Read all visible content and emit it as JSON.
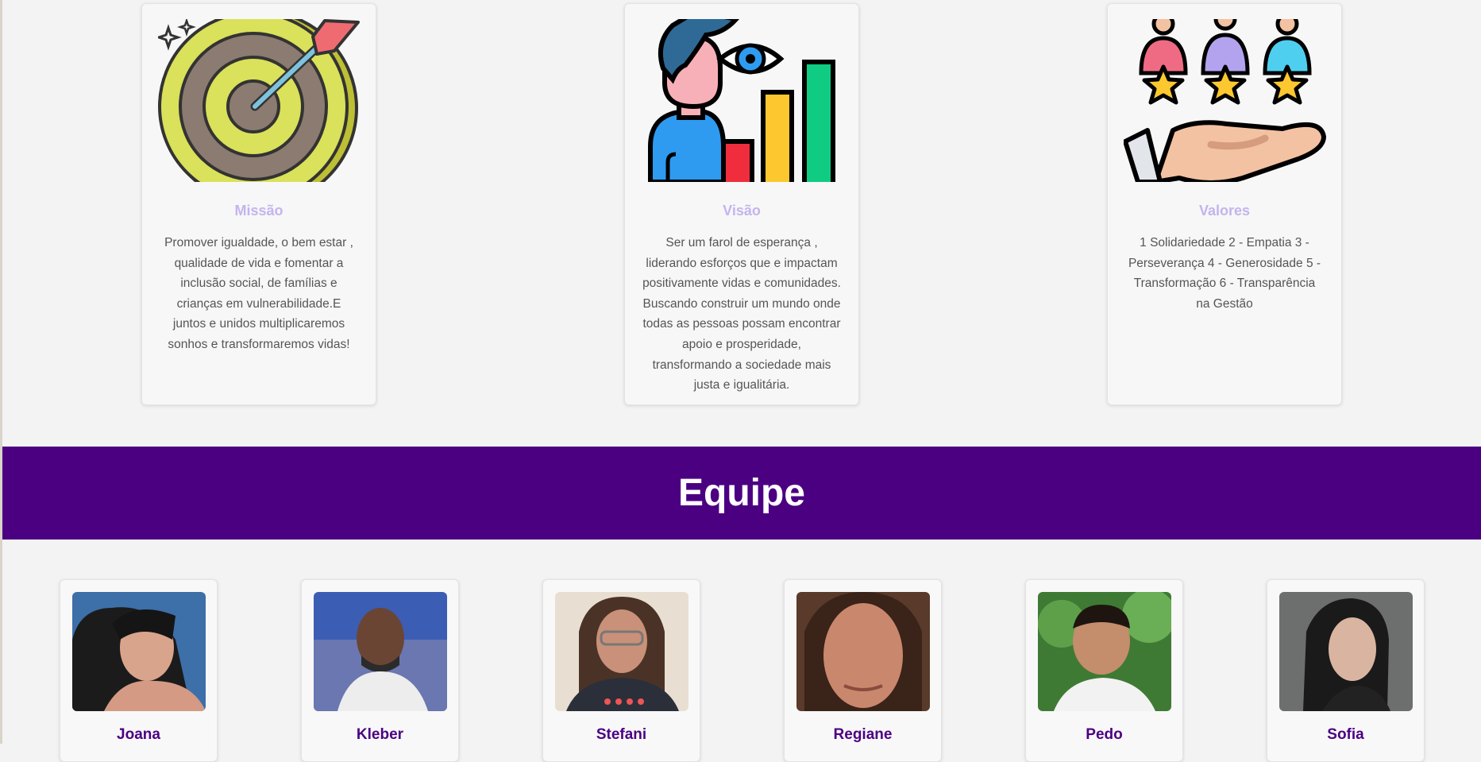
{
  "cards": [
    {
      "icon": "target-icon",
      "title": "Missão",
      "text": "Promover igualdade, o bem estar , qualidade de vida e fomentar a inclusão social, de famílias e crianças em vulnerabilidade.E juntos e unidos multiplicaremos sonhos e transformaremos vidas!"
    },
    {
      "icon": "vision-growth-icon",
      "title": "Visão",
      "text": "Ser um farol de esperança , liderando esforços que e impactam positivamente vidas e comunidades. Buscando construir um mundo onde todas as pessoas possam encontrar apoio e prosperidade, transformando a sociedade mais justa e igualitária."
    },
    {
      "icon": "hand-people-stars-icon",
      "title": "Valores",
      "text": "1 Solidariedade 2 - Empatia 3 - Perseverança 4 - Generosidade 5 - Transformação 6 - Transparência na Gestão"
    }
  ],
  "team": {
    "heading": "Equipe",
    "members": [
      {
        "name": "Joana"
      },
      {
        "name": "Kleber"
      },
      {
        "name": "Stefani"
      },
      {
        "name": "Regiane"
      },
      {
        "name": "Pedo"
      },
      {
        "name": "Sofia"
      }
    ]
  },
  "colors": {
    "banner": "#4b0082",
    "card_title": "#c4b4ef",
    "member_name": "#4b0082",
    "page_background": "#f3f3f3"
  }
}
